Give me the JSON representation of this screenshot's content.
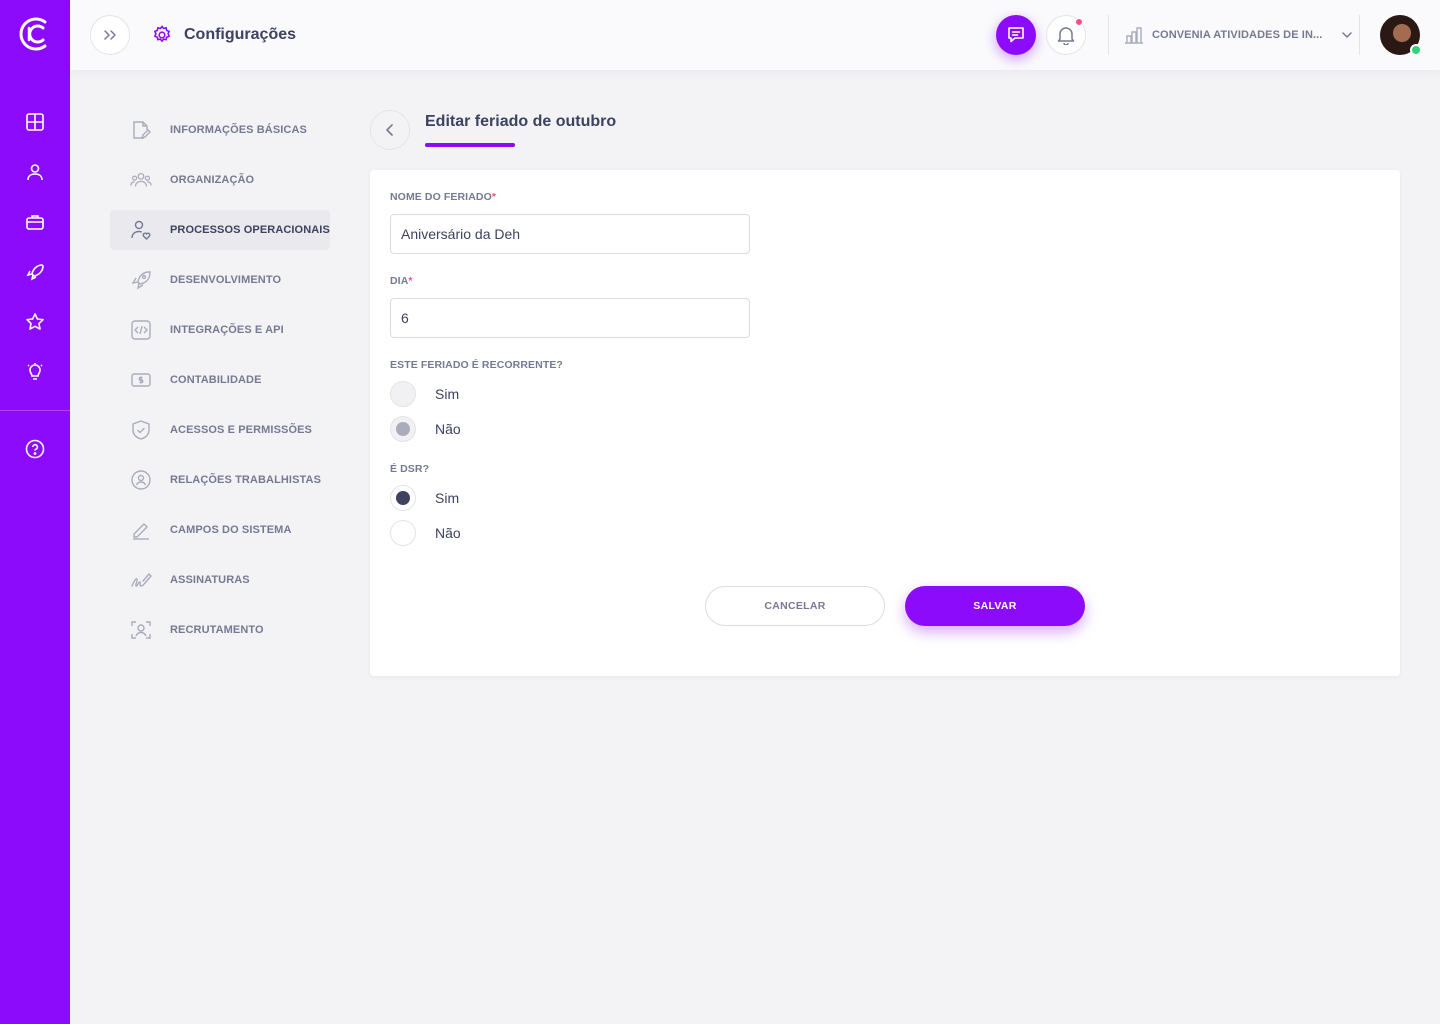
{
  "header": {
    "title": "Configurações",
    "title_icon": "gear-icon",
    "company": "CONVENIA ATIVIDADES DE IN...",
    "notification_badge_color": "#ff4d7d",
    "status": "online"
  },
  "rail": {
    "brand_color": "#8c0bfa",
    "items": [
      {
        "icon": "dashboard-grid-icon"
      },
      {
        "icon": "person-icon"
      },
      {
        "icon": "briefcase-icon"
      },
      {
        "icon": "rocket-icon"
      },
      {
        "icon": "star-icon"
      },
      {
        "icon": "lightbulb-icon"
      },
      {
        "icon": "help-circle-icon"
      }
    ]
  },
  "settings_menu": {
    "active_index": 2,
    "items": [
      {
        "label": "INFORMAÇÕES BÁSICAS",
        "icon": "document-edit-icon"
      },
      {
        "label": "ORGANIZAÇÃO",
        "icon": "team-icon"
      },
      {
        "label": "PROCESSOS OPERACIONAIS",
        "icon": "person-heart-icon"
      },
      {
        "label": "DESENVOLVIMENTO",
        "icon": "rocket-icon"
      },
      {
        "label": "INTEGRAÇÕES E API",
        "icon": "code-icon"
      },
      {
        "label": "CONTABILIDADE",
        "icon": "money-icon"
      },
      {
        "label": "ACESSOS E PERMISSÕES",
        "icon": "shield-check-icon"
      },
      {
        "label": "RELAÇÕES TRABALHISTAS",
        "icon": "user-circle-icon"
      },
      {
        "label": "CAMPOS DO SISTEMA",
        "icon": "pencil-icon"
      },
      {
        "label": "ASSINATURAS",
        "icon": "signature-icon"
      },
      {
        "label": "RECRUTAMENTO",
        "icon": "face-scan-icon"
      }
    ]
  },
  "form": {
    "title": "Editar feriado de outubro",
    "name_label": "NOME DO FERIADO",
    "name_value": "Aniversário da Deh",
    "day_label": "DIA",
    "day_value": "6",
    "required_mark": "*",
    "recurring_label": "ESTE FERIADO É RECORRENTE?",
    "recurring_options": [
      {
        "label": "Sim",
        "state": "unselected-disabled"
      },
      {
        "label": "Não",
        "state": "selected-disabled"
      }
    ],
    "dsr_label": "É DSR?",
    "dsr_options": [
      {
        "label": "Sim",
        "state": "selected"
      },
      {
        "label": "Não",
        "state": "unselected"
      }
    ],
    "cancel_label": "CANCELAR",
    "save_label": "SALVAR"
  }
}
